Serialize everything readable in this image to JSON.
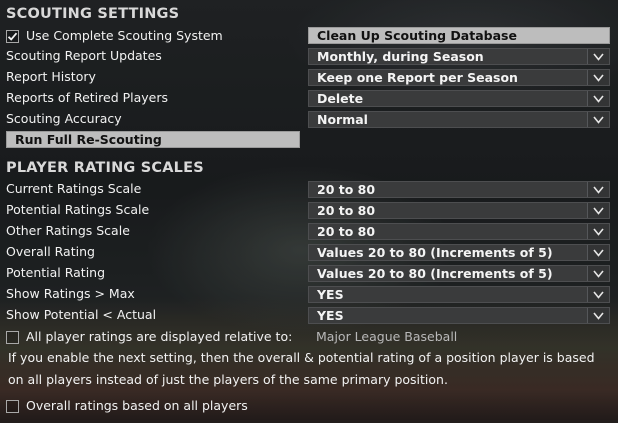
{
  "sections": {
    "scouting_title": "SCOUTING SETTINGS",
    "ratings_title": "PLAYER RATING SCALES"
  },
  "scouting": {
    "use_complete_label": "Use Complete Scouting System",
    "use_complete_checked": true,
    "cleanup_button": "Clean Up Scouting Database",
    "rows": [
      {
        "label": "Scouting Report Updates",
        "value": "Monthly, during Season"
      },
      {
        "label": "Report History",
        "value": "Keep one Report per Season"
      },
      {
        "label": "Reports of Retired Players",
        "value": "Delete"
      },
      {
        "label": "Scouting Accuracy",
        "value": "Normal"
      }
    ],
    "rescout_button": "Run Full Re-Scouting"
  },
  "ratings": {
    "rows": [
      {
        "label": "Current Ratings Scale",
        "value": "20 to 80"
      },
      {
        "label": "Potential Ratings Scale",
        "value": "20 to 80"
      },
      {
        "label": "Other Ratings Scale",
        "value": "20 to 80"
      },
      {
        "label": "Overall Rating",
        "value": "Values 20 to 80 (Increments of 5)"
      },
      {
        "label": "Potential Rating",
        "value": "Values 20 to 80 (Increments of 5)"
      },
      {
        "label": "Show Ratings > Max",
        "value": "YES"
      },
      {
        "label": "Show Potential < Actual",
        "value": "YES"
      }
    ],
    "relative_label": "All player ratings are displayed relative to:",
    "relative_checked": false,
    "relative_value": "Major League Baseball",
    "info_text": "If you enable the next setting, then the overall & potential rating of a position player is based on all players instead of just the players of the same primary position.",
    "all_players_label": "Overall ratings based on all players",
    "all_players_checked": false
  },
  "icons": {
    "dropdown_arrow": "chevron-down-icon",
    "check": "checkmark-icon"
  },
  "colors": {
    "dropdown_bg": "#3a3b3c",
    "button_bg": "#bdbdbd",
    "text": "#f2f2f2"
  }
}
